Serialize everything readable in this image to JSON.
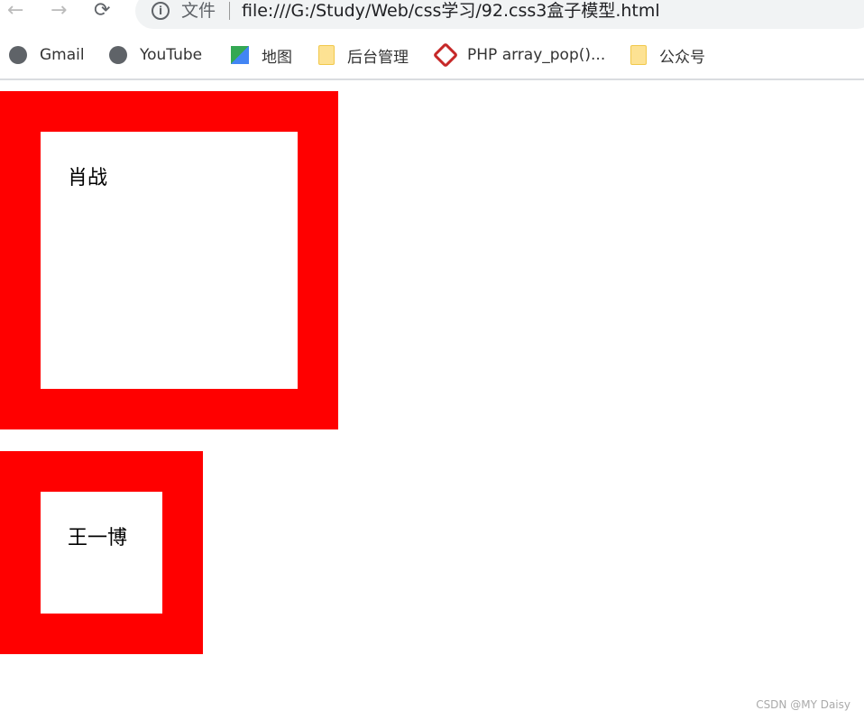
{
  "browser": {
    "back_icon": "arrow-left",
    "forward_icon": "arrow-right",
    "reload_icon": "reload",
    "security_label": "文件",
    "url": "file:///G:/Study/Web/css学习/92.css3盒子模型.html"
  },
  "bookmarks": [
    {
      "label": "Gmail",
      "icon": "globe"
    },
    {
      "label": "YouTube",
      "icon": "globe"
    },
    {
      "label": "地图",
      "icon": "maps"
    },
    {
      "label": "后台管理",
      "icon": "folder"
    },
    {
      "label": "PHP array_pop()...",
      "icon": "php-site"
    },
    {
      "label": "公众号",
      "icon": "folder"
    }
  ],
  "page": {
    "box1": {
      "text": "肖战",
      "border_color": "#ff0000"
    },
    "box2": {
      "text": "王一博",
      "border_color": "#ff0000"
    }
  },
  "watermark": "CSDN @MY Daisy"
}
